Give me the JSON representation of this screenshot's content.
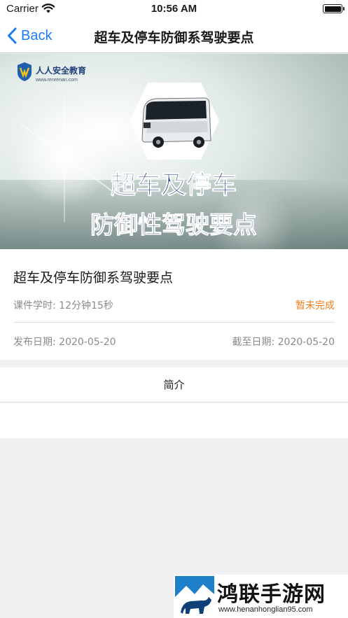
{
  "status_bar": {
    "carrier": "Carrier",
    "time": "10:56 AM"
  },
  "nav": {
    "back_label": "Back",
    "title": "超车及停车防御系驾驶要点"
  },
  "banner": {
    "logo_text": "人人安全教育",
    "logo_url": "www.renrenan.com",
    "headline_line1": "超车及停车",
    "headline_line2": "防御性驾驶要点"
  },
  "course": {
    "title": "超车及停车防御系驾驶要点",
    "duration": "课件学时: 12分钟15秒",
    "status": "暂未完成",
    "publish_date": "发布日期: 2020-05-20",
    "deadline_date": "截至日期: 2020-05-20"
  },
  "tabs": {
    "intro_label": "简介"
  },
  "watermark": {
    "name": "鸿联手游网",
    "url": "www.henanhonglian95.com"
  },
  "colors": {
    "accent_blue": "#1a7cf5",
    "status_orange": "#f07c1c",
    "banner_text_blue": "#1f3f7a"
  },
  "icons": [
    "wifi-icon",
    "battery-icon",
    "back-chevron-icon",
    "shield-logo-icon",
    "bus-icon"
  ]
}
